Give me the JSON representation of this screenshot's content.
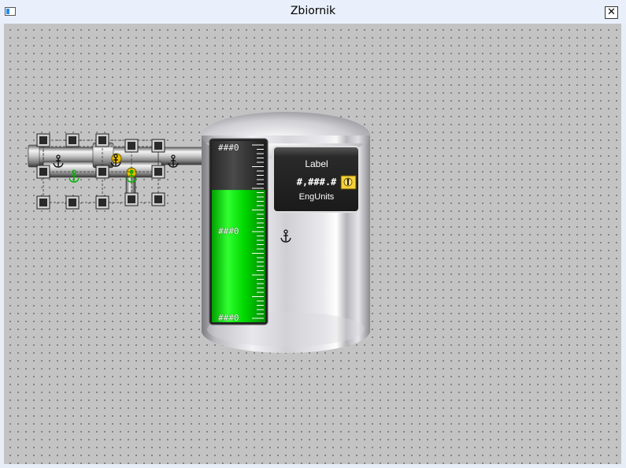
{
  "window": {
    "title": "Zbiornik",
    "close_glyph": "✕"
  },
  "tank": {
    "level_fraction": 0.73,
    "scale_labels": {
      "top": "###0",
      "middle": "###0",
      "bottom": "###0"
    },
    "display": {
      "label": "Label",
      "value": "#,###.#",
      "units": "EngUnits"
    },
    "fill_color": "#00d000"
  },
  "icons": {
    "window_icon": "app-window-icon",
    "lock": "lock-icon",
    "anchor": "anchor-icon"
  }
}
